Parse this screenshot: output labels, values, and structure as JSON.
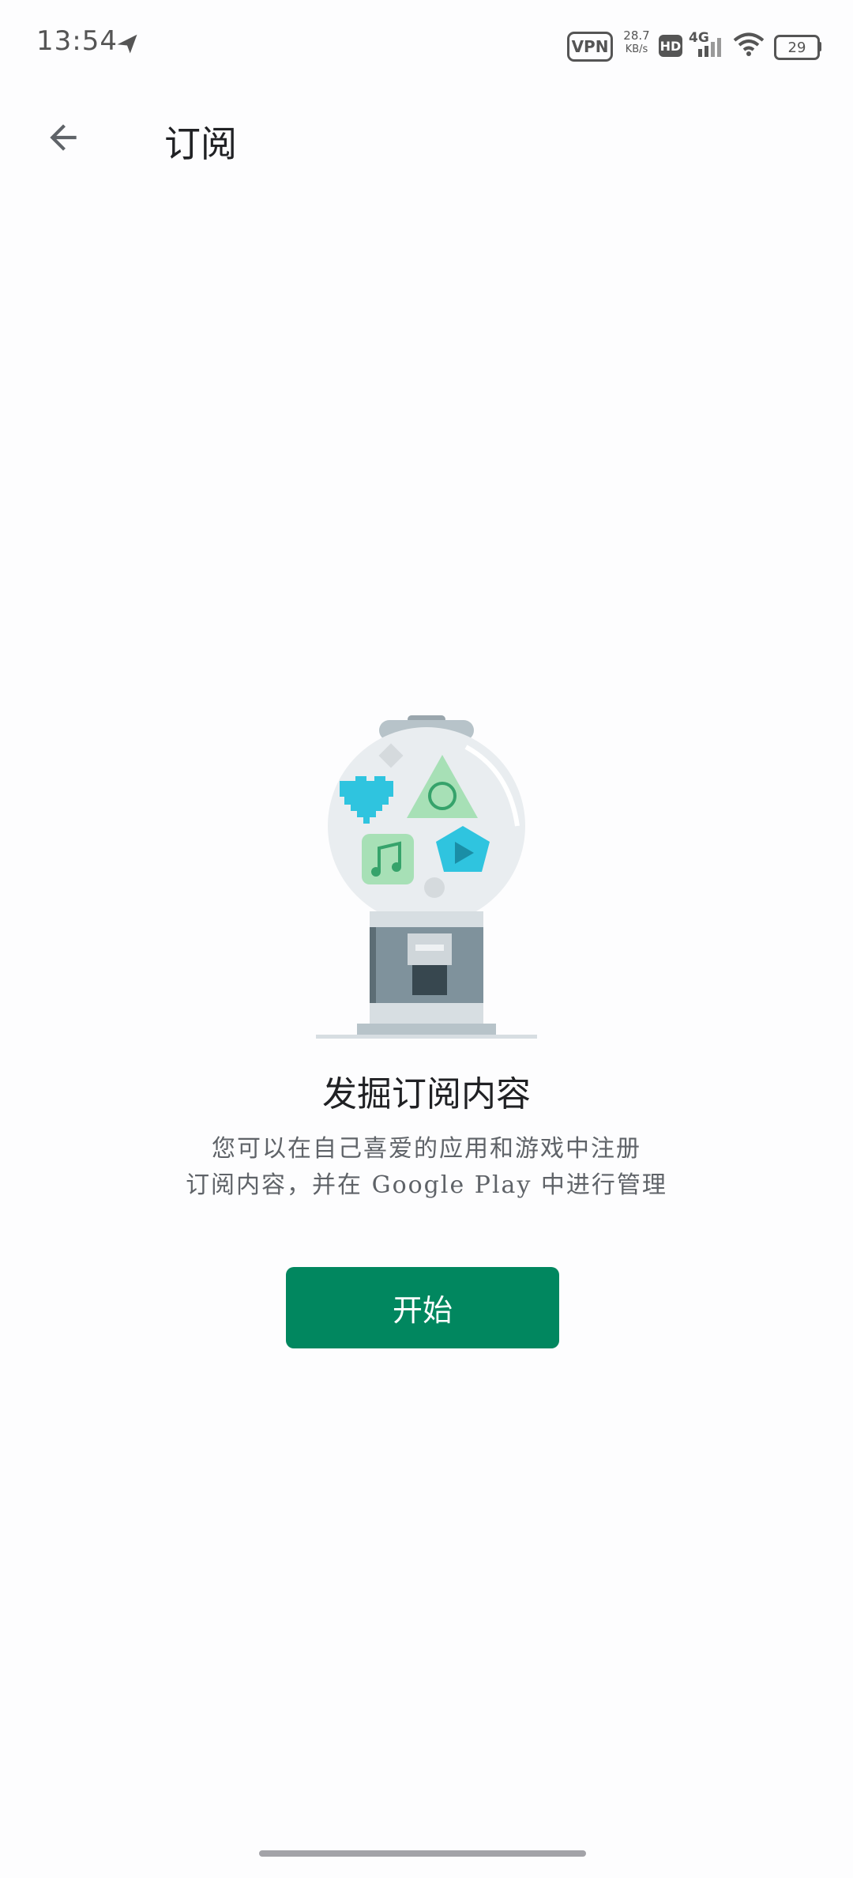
{
  "status_bar": {
    "time": "13:54",
    "vpn_label": "VPN",
    "speed_value": "28.7",
    "speed_unit": "KB/s",
    "hd_label": "HD",
    "network_label": "4G",
    "battery_level": "29"
  },
  "app_bar": {
    "title": "订阅"
  },
  "empty_state": {
    "headline": "发掘订阅内容",
    "description_line1": "您可以在自己喜爱的应用和游戏中注册",
    "description_line2": "订阅内容，并在 Google Play 中进行管理",
    "start_button_label": "开始"
  },
  "colors": {
    "accent": "#01875f",
    "icon_gray": "#5f6368"
  }
}
